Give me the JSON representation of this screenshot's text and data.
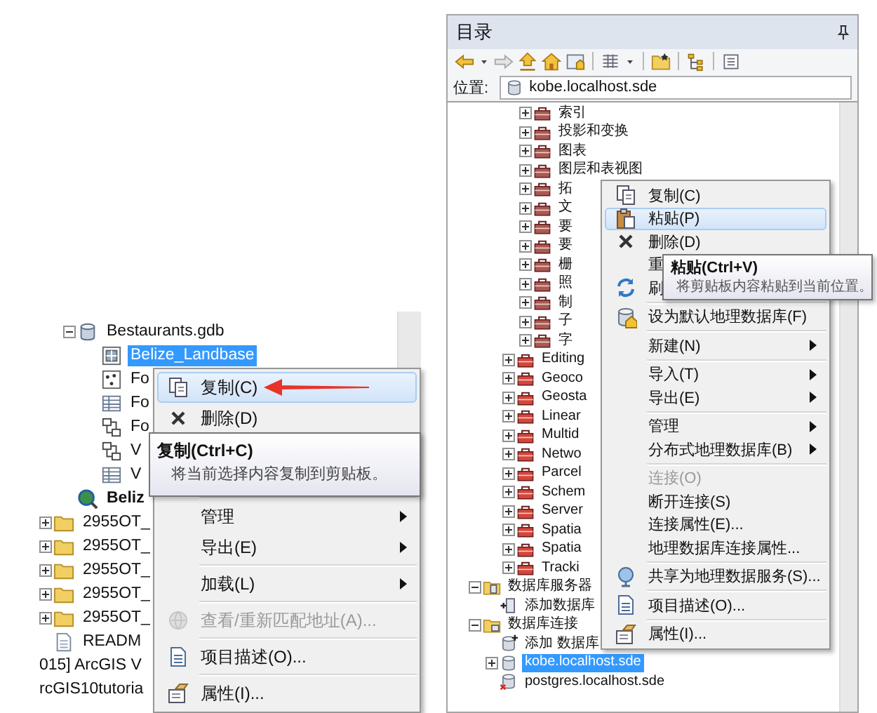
{
  "left_panel": {
    "tree": [
      {
        "children": [
          {
            "children": [
              {
                "label": "Bestaurants.gdb",
                "kind": "gdb",
                "expanded": true,
                "selected": false,
                "children": [
                  {
                    "label": "Belize_Landbase",
                    "kind": "raster",
                    "selected": true
                  },
                  {
                    "label": "Fo",
                    "kind": "points",
                    "selected": false
                  },
                  {
                    "label": "Fo",
                    "kind": "table",
                    "selected": false
                  },
                  {
                    "label": "Fo",
                    "kind": "topology",
                    "selected": false
                  },
                  {
                    "label": "V",
                    "kind": "topology",
                    "selected": false
                  },
                  {
                    "label": "V",
                    "kind": "table",
                    "selected": false
                  }
                ]
              },
              {
                "label": "Beliz",
                "kind": "locator",
                "selected": false,
                "bold": true
              }
            ]
          },
          {
            "label": "2955OT_",
            "kind": "folder",
            "expanded": false,
            "selected": false
          },
          {
            "label": "2955OT_",
            "kind": "folder",
            "expanded": false,
            "selected": false
          },
          {
            "label": "2955OT_",
            "kind": "folder",
            "expanded": false,
            "selected": false
          },
          {
            "label": "2955OT_",
            "kind": "folder",
            "expanded": false,
            "selected": false
          },
          {
            "label": "2955OT_",
            "kind": "folder",
            "expanded": false,
            "selected": false
          },
          {
            "label": "READM",
            "kind": "file",
            "selected": false
          }
        ]
      },
      {
        "label": "015] ArcGIS V",
        "selected": false
      },
      {
        "label": "rcGIS10tutoria",
        "selected": false
      }
    ],
    "context_menu": {
      "items": [
        {
          "kind": "copy",
          "label": "复制(C)",
          "disabled": false,
          "selected": true
        },
        {
          "kind": "delete",
          "label": "删除(D)",
          "disabled": false,
          "selected": false
        },
        {
          "kind": "covered"
        },
        {
          "kind": "covered"
        },
        {
          "kind": "separator"
        },
        {
          "kind": "plain",
          "label": "管理",
          "submenu": true,
          "disabled": false,
          "selected": false
        },
        {
          "kind": "plain",
          "label": "导出(E)",
          "submenu": true,
          "disabled": false,
          "selected": false
        },
        {
          "kind": "separator"
        },
        {
          "kind": "plain",
          "label": "加载(L)",
          "submenu": true,
          "disabled": false,
          "selected": false
        },
        {
          "kind": "separator"
        },
        {
          "kind": "geocode",
          "label": "查看/重新匹配地址(A)...",
          "disabled": true,
          "selected": false
        },
        {
          "kind": "separator"
        },
        {
          "kind": "doc",
          "label": "项目描述(O)...",
          "disabled": false,
          "selected": false
        },
        {
          "kind": "separator"
        },
        {
          "kind": "properties",
          "label": "属性(I)...",
          "disabled": false,
          "selected": false
        }
      ]
    },
    "tooltip": {
      "title": "复制(Ctrl+C)",
      "description": "将当前选择内容复制到剪贴板。"
    }
  },
  "right_panel": {
    "title": "目录",
    "location": {
      "label": "位置:",
      "value": "kobe.localhost.sde"
    },
    "tree": [
      {
        "children": [
          {
            "children": [
              {
                "children": [
                  {
                    "label": "索引",
                    "kind": "toolset",
                    "expanded": false,
                    "selected": false
                  },
                  {
                    "label": "投影和变换",
                    "kind": "toolset",
                    "expanded": false,
                    "selected": false
                  },
                  {
                    "label": "图表",
                    "kind": "toolset",
                    "expanded": false,
                    "selected": false
                  },
                  {
                    "label": "图层和表视图",
                    "kind": "toolset",
                    "expanded": false,
                    "selected": false
                  },
                  {
                    "label": "拓",
                    "kind": "toolset",
                    "expanded": false,
                    "selected": false
                  },
                  {
                    "label": "文",
                    "kind": "toolset",
                    "expanded": false,
                    "selected": false
                  },
                  {
                    "label": "要",
                    "kind": "toolset",
                    "expanded": false,
                    "selected": false
                  },
                  {
                    "label": "要",
                    "kind": "toolset",
                    "expanded": false,
                    "selected": false
                  },
                  {
                    "label": "栅",
                    "kind": "toolset",
                    "expanded": false,
                    "selected": false
                  },
                  {
                    "label": "照",
                    "kind": "toolset",
                    "expanded": false,
                    "selected": false
                  },
                  {
                    "label": "制",
                    "kind": "toolset",
                    "expanded": false,
                    "selected": false
                  },
                  {
                    "label": "子",
                    "kind": "toolset",
                    "expanded": false,
                    "selected": false
                  },
                  {
                    "label": "字",
                    "kind": "toolset",
                    "expanded": false,
                    "selected": false
                  }
                ]
              },
              {
                "label": "Editing",
                "kind": "toolbox",
                "expanded": false,
                "selected": false
              },
              {
                "label": "Geoco",
                "kind": "toolbox",
                "expanded": false,
                "selected": false
              },
              {
                "label": "Geosta",
                "kind": "toolbox",
                "expanded": false,
                "selected": false
              },
              {
                "label": "Linear",
                "kind": "toolbox",
                "expanded": false,
                "selected": false
              },
              {
                "label": "Multid",
                "kind": "toolbox",
                "expanded": false,
                "selected": false
              },
              {
                "label": "Netwo",
                "kind": "toolbox",
                "expanded": false,
                "selected": false
              },
              {
                "label": "Parcel",
                "kind": "toolbox",
                "expanded": false,
                "selected": false
              },
              {
                "label": "Schem",
                "kind": "toolbox",
                "expanded": false,
                "selected": false
              },
              {
                "label": "Server",
                "kind": "toolbox",
                "expanded": false,
                "selected": false
              },
              {
                "label": "Spatia",
                "kind": "toolbox",
                "expanded": false,
                "selected": false
              },
              {
                "label": "Spatia",
                "kind": "toolbox",
                "expanded": false,
                "selected": false
              },
              {
                "label": "Tracki",
                "kind": "toolbox",
                "expanded": false,
                "selected": false
              }
            ]
          }
        ]
      },
      {
        "label": "数据库服务器",
        "kind": "server-folder",
        "expanded": true,
        "selected": false,
        "children": [
          {
            "label": "添加数据库",
            "kind": "add-server",
            "selected": false
          }
        ]
      },
      {
        "label": "数据库连接",
        "kind": "connections-folder",
        "expanded": true,
        "selected": false,
        "children": [
          {
            "label": "添加 数据库",
            "kind": "add-connection",
            "selected": false
          },
          {
            "label": "kobe.localhost.sde",
            "kind": "sde",
            "expanded": false,
            "selected": true
          },
          {
            "label": "postgres.localhost.sde",
            "kind": "sde-error",
            "selected": false
          }
        ]
      }
    ],
    "context_menu": {
      "items": [
        {
          "kind": "copy",
          "label": "复制(C)",
          "disabled": false,
          "selected": false
        },
        {
          "kind": "paste",
          "label": "粘贴(P)",
          "disabled": false,
          "selected": true
        },
        {
          "kind": "delete",
          "label": "删除(D)",
          "disabled": false,
          "selected": false
        },
        {
          "kind": "plain",
          "label": "重",
          "disabled": false,
          "selected": false
        },
        {
          "kind": "refresh",
          "label": "刷",
          "disabled": false,
          "selected": false
        },
        {
          "kind": "separator"
        },
        {
          "kind": "gdb-home",
          "label": "设为默认地理数据库(F)",
          "disabled": false,
          "selected": false
        },
        {
          "kind": "separator"
        },
        {
          "kind": "plain",
          "label": "新建(N)",
          "submenu": true,
          "disabled": false,
          "selected": false
        },
        {
          "kind": "separator"
        },
        {
          "kind": "plain",
          "label": "导入(T)",
          "submenu": true,
          "disabled": false,
          "selected": false
        },
        {
          "kind": "plain",
          "label": "导出(E)",
          "submenu": true,
          "disabled": false,
          "selected": false
        },
        {
          "kind": "separator"
        },
        {
          "kind": "plain",
          "label": "管理",
          "submenu": true,
          "disabled": false,
          "selected": false
        },
        {
          "kind": "plain",
          "label": "分布式地理数据库(B)",
          "submenu": true,
          "disabled": false,
          "selected": false
        },
        {
          "kind": "separator"
        },
        {
          "kind": "plain",
          "label": "连接(O)",
          "disabled": true,
          "selected": false
        },
        {
          "kind": "plain",
          "label": "断开连接(S)",
          "disabled": false,
          "selected": false
        },
        {
          "kind": "plain",
          "label": "连接属性(E)...",
          "disabled": false,
          "selected": false
        },
        {
          "kind": "plain",
          "label": "地理数据库连接属性...",
          "disabled": false,
          "selected": false
        },
        {
          "kind": "separator"
        },
        {
          "kind": "share",
          "label": "共享为地理数据服务(S)...",
          "disabled": false,
          "selected": false
        },
        {
          "kind": "separator"
        },
        {
          "kind": "doc",
          "label": "项目描述(O)...",
          "disabled": false,
          "selected": false
        },
        {
          "kind": "separator"
        },
        {
          "kind": "properties",
          "label": "属性(I)...",
          "disabled": false,
          "selected": false
        }
      ]
    },
    "tooltip": {
      "title": "粘贴(Ctrl+V)",
      "description": "将剪贴板内容粘贴到当前位置。"
    }
  }
}
